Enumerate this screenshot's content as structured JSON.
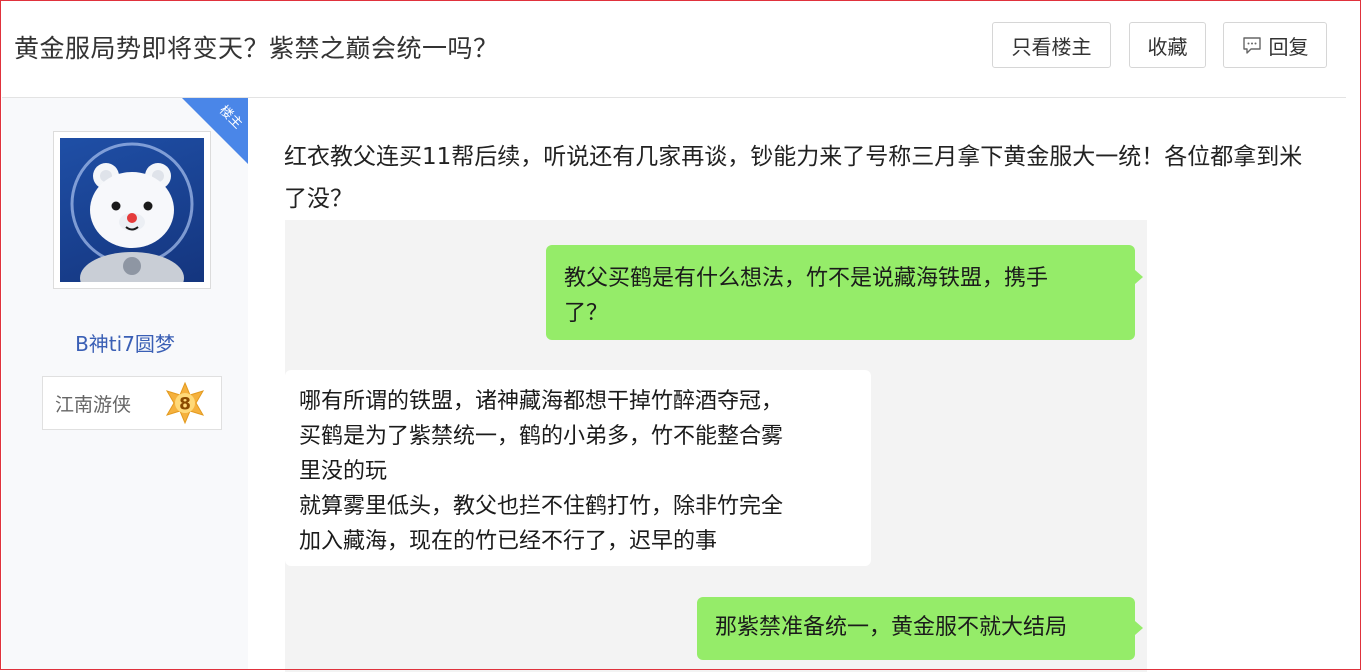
{
  "header": {
    "title": "黄金服局势即将变天？紫禁之巅会统一吗？",
    "only_op_label": "只看楼主",
    "favorite_label": "收藏",
    "reply_label": "回复"
  },
  "corner_badge": "楼主",
  "user": {
    "name": "B神ti7圆梦",
    "rank_title": "江南游侠",
    "level": "8"
  },
  "post": {
    "text": "红衣教父连买11帮后续，听说还有几家再谈，钞能力来了号称三月拿下黄金服大一统！各位都拿到米了没？",
    "chat": [
      {
        "side": "right",
        "lines": [
          "教父买鹤是有什么想法，竹不是说藏海铁盟，携手",
          "了？"
        ]
      },
      {
        "side": "left",
        "lines": [
          "哪有所谓的铁盟，诸神藏海都想干掉竹醉酒夺冠，",
          "买鹤是为了紫禁统一，鹤的小弟多，竹不能整合雾",
          "里没的玩",
          "就算雾里低头，教父也拦不住鹤打竹，除非竹完全",
          "加入藏海，现在的竹已经不行了，迟早的事"
        ]
      },
      {
        "side": "right",
        "lines": [
          "那紫禁准备统一，黄金服不就大结局"
        ]
      }
    ]
  },
  "colors": {
    "accent_blue": "#4a86e8",
    "username_blue": "#3a5fb5",
    "chat_green": "#95ec69",
    "frame_red": "#e0323c"
  },
  "icons": {
    "reply": "speech-bubble-icon",
    "level_badge": "star-badge-icon"
  }
}
